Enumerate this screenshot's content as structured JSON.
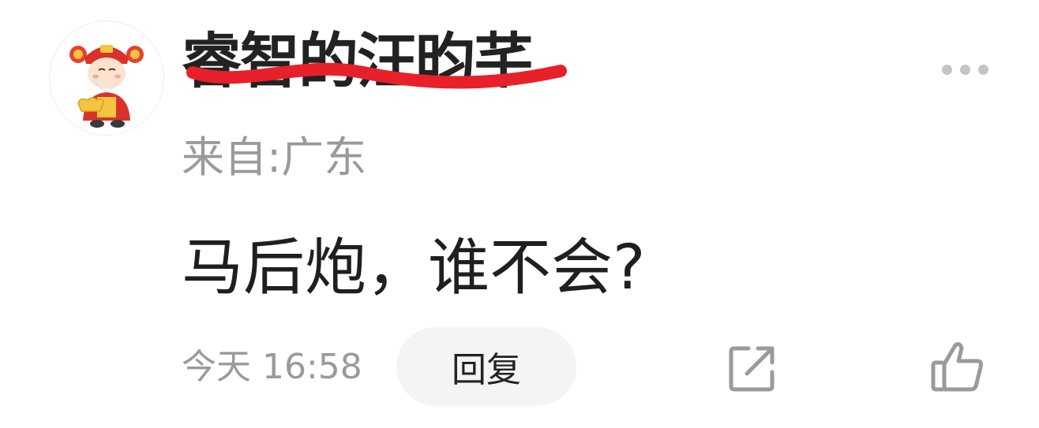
{
  "comment": {
    "avatar_icon": "caishen-avatar-icon",
    "username": "睿智的汪昀芊",
    "location": "来自:广东",
    "content": "马后炮，谁不会?",
    "timestamp": "今天 16:58",
    "reply_label": "回复",
    "more_icon": "more-dots-icon",
    "share_icon": "share-icon",
    "like_icon": "thumbs-up-icon"
  },
  "colors": {
    "redaction": "#e8202a",
    "secondary_text": "#9a9a9a",
    "primary_text": "#222222",
    "reply_bg": "#f4f4f4",
    "icon_gray": "#9a9a9a"
  }
}
